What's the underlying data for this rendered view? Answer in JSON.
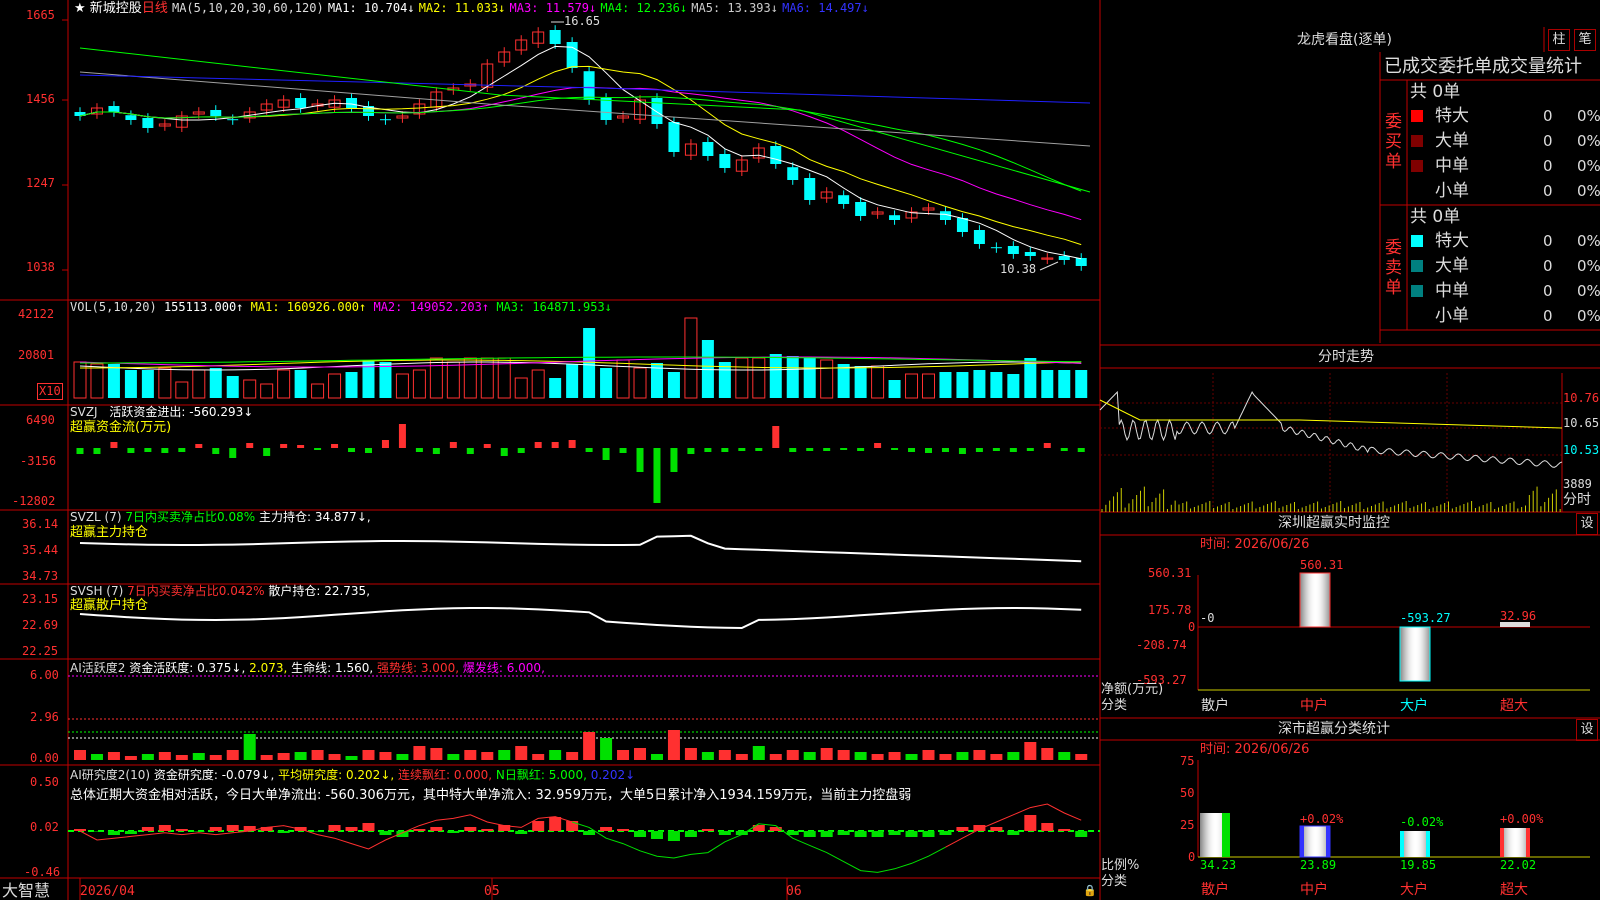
{
  "colors": {
    "up": "#ff3030",
    "down": "#00ffff",
    "grid": "#c00000",
    "ma1": "#ffffff",
    "ma2": "#ffff00",
    "ma3": "#ff00ff",
    "ma4": "#00ff00",
    "ma5": "#a0a0a0",
    "ma6": "#2020ff",
    "green": "#00e000"
  },
  "main": {
    "title": "新城控股",
    "period": "日线",
    "ma_label": "MA(5,10,20,30,60,120)",
    "ma": [
      {
        "n": "MA1:",
        "v": "10.704↓"
      },
      {
        "n": "MA2:",
        "v": "11.033↓"
      },
      {
        "n": "MA3:",
        "v": "11.579↓"
      },
      {
        "n": "MA4:",
        "v": "12.236↓"
      },
      {
        "n": "MA5:",
        "v": "13.393↓"
      },
      {
        "n": "MA6:",
        "v": "14.497↓"
      }
    ],
    "y_labels": [
      "1665",
      "1456",
      "1247",
      "1038"
    ],
    "high_label": "16.65",
    "low_label": "10.38"
  },
  "vol": {
    "label": "VOL(5,10,20)",
    "value": "155113.000↑",
    "ma1": "MA1: 160926.000↑",
    "ma2": "MA2: 149052.203↑",
    "ma3": "MA3: 164871.953↓",
    "y_labels": [
      "42122",
      "20801"
    ],
    "unit": "X10"
  },
  "svzj": {
    "label": "SVZJ",
    "active": "活跃资金进出: -560.293↓",
    "sub": "超赢资金流(万元)",
    "y_labels": [
      "6490",
      "-3156",
      "-12802"
    ]
  },
  "svzl": {
    "label": "SVZL (7)",
    "pct": "7日内买卖净占比0.08%",
    "main": "主力持仓: 34.877↓,",
    "sub": "超赢主力持仓",
    "y_labels": [
      "36.14",
      "35.44",
      "34.73"
    ]
  },
  "svsh": {
    "label": "SVSH (7)",
    "pct": "7日内买卖净占比0.042%",
    "main": "散户持仓: 22.735,",
    "sub": "超赢散户持仓",
    "y_labels": [
      "23.15",
      "22.69",
      "22.25"
    ]
  },
  "ai1": {
    "label": "AI活跃度2",
    "v1": "资金活跃度: 0.375↓,",
    "v2": "2.073,",
    "v3": "生命线: 1.560,",
    "v4": "强势线: 3.000,",
    "v5": "爆发线: 6.000,",
    "y_labels": [
      "6.00",
      "2.96",
      "0.00"
    ]
  },
  "ai2": {
    "label": "AI研究度2(10)",
    "v1": "资金研究度: -0.079↓,",
    "v2": "平均研究度: 0.202↓,",
    "v3": "连续飘红: 0.000,",
    "v4": "N日飘红: 5.000,",
    "v5": "0.202↓",
    "summary": "总体近期大资金相对活跃，今日大单净流出: -560.306万元，其中特大单净流入: 32.959万元，大单5日累计净入1934.159万元，当前主力控盘弱",
    "y_labels": [
      "0.50",
      "0.02",
      "-0.46"
    ]
  },
  "xaxis": {
    "labels": [
      "2026/04",
      "05",
      "06"
    ],
    "brand": "大智慧"
  },
  "lhb": {
    "title": "龙虎看盘(逐单)",
    "btn1": "柱",
    "btn2": "笔",
    "header": "已成交委托单成交量统计",
    "buy": {
      "side": "委买单",
      "total": "共 0单",
      "rows": [
        {
          "n": "特大",
          "v": "0",
          "p": "0%"
        },
        {
          "n": "大单",
          "v": "0",
          "p": "0%"
        },
        {
          "n": "中单",
          "v": "0",
          "p": "0%"
        },
        {
          "n": "小单",
          "v": "0",
          "p": "0%"
        }
      ]
    },
    "sell": {
      "side": "委卖单",
      "total": "共 0单",
      "rows": [
        {
          "n": "特大",
          "v": "0",
          "p": "0%"
        },
        {
          "n": "大单",
          "v": "0",
          "p": "0%"
        },
        {
          "n": "中单",
          "v": "0",
          "p": "0%"
        },
        {
          "n": "小单",
          "v": "0",
          "p": "0%"
        }
      ]
    }
  },
  "fenshi": {
    "title": "分时走势",
    "y_labels": [
      "10.76",
      "10.65",
      "10.53"
    ],
    "vol_label": "3889",
    "unit": "分时"
  },
  "sz_monitor": {
    "title": "深圳超赢实时监控",
    "btn": "设",
    "time": "时间: 2026/06/26",
    "y_labels": [
      "560.31",
      "175.78",
      "0",
      "-208.74",
      "-593.27"
    ],
    "unit_label": "净额(万元)",
    "cat_label": "分类",
    "categories": [
      "散户",
      "中户",
      "大户",
      "超大"
    ],
    "values": [
      "-0",
      "560.31",
      "-593.27",
      "32.96"
    ]
  },
  "sz_class": {
    "title": "深市超赢分类统计",
    "btn": "设",
    "time": "时间: 2026/06/26",
    "y_labels": [
      "75",
      "50",
      "25",
      "0"
    ],
    "ratio_label": "比例%",
    "cat_label": "分类",
    "categories": [
      "散户",
      "中户",
      "大户",
      "超大"
    ],
    "values": [
      "34.23",
      "23.89",
      "19.85",
      "22.02"
    ],
    "changes": [
      "",
      "+0.02%",
      "-0.02%",
      "+0.00%"
    ]
  },
  "chart_data": {
    "type": "candlestick",
    "title": "新城控股 日线",
    "ylim": [
      10.38,
      16.65
    ],
    "high": 16.65,
    "low": 10.38,
    "ma": {
      "MA1": 10.704,
      "MA2": 11.033,
      "MA3": 11.579,
      "MA4": 12.236,
      "MA5": 13.393,
      "MA6": 14.497
    },
    "x_labels": [
      "2026/04",
      "05",
      "06"
    ]
  }
}
